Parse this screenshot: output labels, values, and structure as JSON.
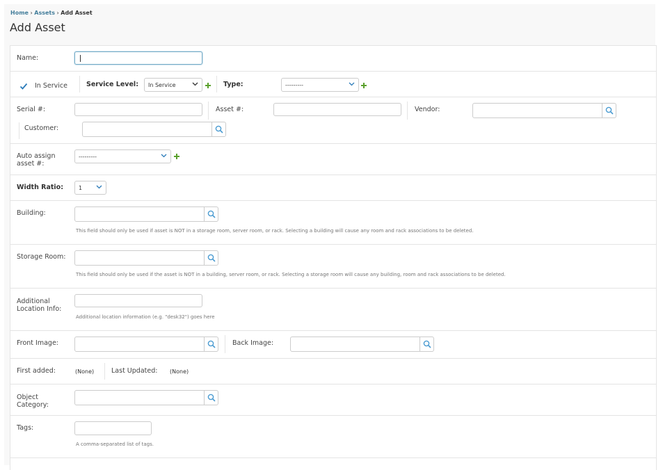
{
  "breadcrumb": {
    "home": "Home",
    "assets": "Assets",
    "current": "Add Asset",
    "sep": "›"
  },
  "page_title": "Add Asset",
  "fields": {
    "name": {
      "label": "Name:",
      "value": ""
    },
    "in_service": {
      "label": "In Service",
      "checked": true
    },
    "service_level": {
      "label": "Service Level:",
      "value": "In Service"
    },
    "type": {
      "label": "Type:",
      "value": "---------"
    },
    "serial": {
      "label": "Serial #:",
      "value": ""
    },
    "asset_num": {
      "label": "Asset #:",
      "value": ""
    },
    "vendor": {
      "label": "Vendor:",
      "value": ""
    },
    "customer": {
      "label": "Customer:",
      "value": ""
    },
    "auto_assign": {
      "label_line1": "Auto assign",
      "label_line2": "asset #:",
      "value": "---------"
    },
    "width_ratio": {
      "label": "Width Ratio:",
      "value": "1"
    },
    "building": {
      "label": "Building:",
      "value": "",
      "help": "This field should only be used if asset is NOT in a storage room, server room, or rack. Selecting a building will cause any room and rack associations to be deleted."
    },
    "storage_room": {
      "label": "Storage Room:",
      "value": "",
      "help": "This field should only be used if the asset is NOT in a building, server room, or rack. Selecting a storage room will cause any building, room and rack associations to be deleted."
    },
    "additional_location": {
      "label_line1": "Additional",
      "label_line2": "Location Info:",
      "value": "",
      "help": "Additional location information (e.g. \"desk32\") goes here"
    },
    "front_image": {
      "label": "Front Image:",
      "value": ""
    },
    "back_image": {
      "label": "Back Image:",
      "value": ""
    },
    "first_added": {
      "label": "First added:",
      "value": "(None)"
    },
    "last_updated": {
      "label": "Last Updated:",
      "value": "(None)"
    },
    "object_category": {
      "label_line1": "Object",
      "label_line2": "Category:",
      "value": ""
    },
    "tags": {
      "label": "Tags:",
      "value": "",
      "help": "A comma-separated list of tags."
    }
  },
  "colors": {
    "link": "#447e9b",
    "add_icon": "#5aa02c",
    "search_icon": "#4a9bd1",
    "check": "#2b7bb9"
  }
}
